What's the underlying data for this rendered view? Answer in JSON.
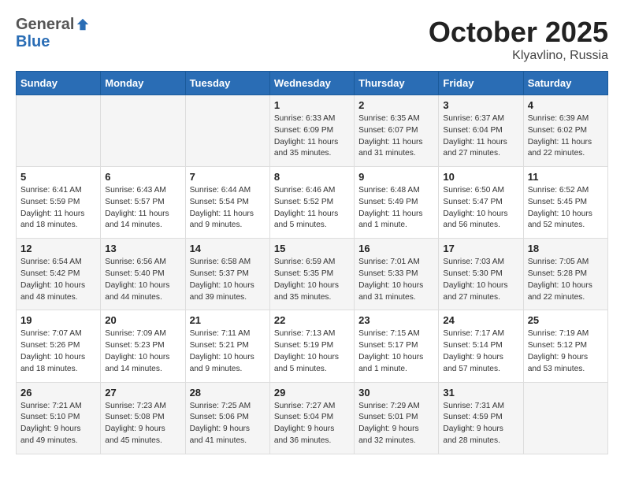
{
  "header": {
    "logo": {
      "general": "General",
      "blue": "Blue"
    },
    "title": "October 2025",
    "location": "Klyavlino, Russia"
  },
  "weekdays": [
    "Sunday",
    "Monday",
    "Tuesday",
    "Wednesday",
    "Thursday",
    "Friday",
    "Saturday"
  ],
  "weeks": [
    [
      {
        "day": "",
        "content": ""
      },
      {
        "day": "",
        "content": ""
      },
      {
        "day": "",
        "content": ""
      },
      {
        "day": "1",
        "content": "Sunrise: 6:33 AM\nSunset: 6:09 PM\nDaylight: 11 hours\nand 35 minutes."
      },
      {
        "day": "2",
        "content": "Sunrise: 6:35 AM\nSunset: 6:07 PM\nDaylight: 11 hours\nand 31 minutes."
      },
      {
        "day": "3",
        "content": "Sunrise: 6:37 AM\nSunset: 6:04 PM\nDaylight: 11 hours\nand 27 minutes."
      },
      {
        "day": "4",
        "content": "Sunrise: 6:39 AM\nSunset: 6:02 PM\nDaylight: 11 hours\nand 22 minutes."
      }
    ],
    [
      {
        "day": "5",
        "content": "Sunrise: 6:41 AM\nSunset: 5:59 PM\nDaylight: 11 hours\nand 18 minutes."
      },
      {
        "day": "6",
        "content": "Sunrise: 6:43 AM\nSunset: 5:57 PM\nDaylight: 11 hours\nand 14 minutes."
      },
      {
        "day": "7",
        "content": "Sunrise: 6:44 AM\nSunset: 5:54 PM\nDaylight: 11 hours\nand 9 minutes."
      },
      {
        "day": "8",
        "content": "Sunrise: 6:46 AM\nSunset: 5:52 PM\nDaylight: 11 hours\nand 5 minutes."
      },
      {
        "day": "9",
        "content": "Sunrise: 6:48 AM\nSunset: 5:49 PM\nDaylight: 11 hours\nand 1 minute."
      },
      {
        "day": "10",
        "content": "Sunrise: 6:50 AM\nSunset: 5:47 PM\nDaylight: 10 hours\nand 56 minutes."
      },
      {
        "day": "11",
        "content": "Sunrise: 6:52 AM\nSunset: 5:45 PM\nDaylight: 10 hours\nand 52 minutes."
      }
    ],
    [
      {
        "day": "12",
        "content": "Sunrise: 6:54 AM\nSunset: 5:42 PM\nDaylight: 10 hours\nand 48 minutes."
      },
      {
        "day": "13",
        "content": "Sunrise: 6:56 AM\nSunset: 5:40 PM\nDaylight: 10 hours\nand 44 minutes."
      },
      {
        "day": "14",
        "content": "Sunrise: 6:58 AM\nSunset: 5:37 PM\nDaylight: 10 hours\nand 39 minutes."
      },
      {
        "day": "15",
        "content": "Sunrise: 6:59 AM\nSunset: 5:35 PM\nDaylight: 10 hours\nand 35 minutes."
      },
      {
        "day": "16",
        "content": "Sunrise: 7:01 AM\nSunset: 5:33 PM\nDaylight: 10 hours\nand 31 minutes."
      },
      {
        "day": "17",
        "content": "Sunrise: 7:03 AM\nSunset: 5:30 PM\nDaylight: 10 hours\nand 27 minutes."
      },
      {
        "day": "18",
        "content": "Sunrise: 7:05 AM\nSunset: 5:28 PM\nDaylight: 10 hours\nand 22 minutes."
      }
    ],
    [
      {
        "day": "19",
        "content": "Sunrise: 7:07 AM\nSunset: 5:26 PM\nDaylight: 10 hours\nand 18 minutes."
      },
      {
        "day": "20",
        "content": "Sunrise: 7:09 AM\nSunset: 5:23 PM\nDaylight: 10 hours\nand 14 minutes."
      },
      {
        "day": "21",
        "content": "Sunrise: 7:11 AM\nSunset: 5:21 PM\nDaylight: 10 hours\nand 9 minutes."
      },
      {
        "day": "22",
        "content": "Sunrise: 7:13 AM\nSunset: 5:19 PM\nDaylight: 10 hours\nand 5 minutes."
      },
      {
        "day": "23",
        "content": "Sunrise: 7:15 AM\nSunset: 5:17 PM\nDaylight: 10 hours\nand 1 minute."
      },
      {
        "day": "24",
        "content": "Sunrise: 7:17 AM\nSunset: 5:14 PM\nDaylight: 9 hours\nand 57 minutes."
      },
      {
        "day": "25",
        "content": "Sunrise: 7:19 AM\nSunset: 5:12 PM\nDaylight: 9 hours\nand 53 minutes."
      }
    ],
    [
      {
        "day": "26",
        "content": "Sunrise: 7:21 AM\nSunset: 5:10 PM\nDaylight: 9 hours\nand 49 minutes."
      },
      {
        "day": "27",
        "content": "Sunrise: 7:23 AM\nSunset: 5:08 PM\nDaylight: 9 hours\nand 45 minutes."
      },
      {
        "day": "28",
        "content": "Sunrise: 7:25 AM\nSunset: 5:06 PM\nDaylight: 9 hours\nand 41 minutes."
      },
      {
        "day": "29",
        "content": "Sunrise: 7:27 AM\nSunset: 5:04 PM\nDaylight: 9 hours\nand 36 minutes."
      },
      {
        "day": "30",
        "content": "Sunrise: 7:29 AM\nSunset: 5:01 PM\nDaylight: 9 hours\nand 32 minutes."
      },
      {
        "day": "31",
        "content": "Sunrise: 7:31 AM\nSunset: 4:59 PM\nDaylight: 9 hours\nand 28 minutes."
      },
      {
        "day": "",
        "content": ""
      }
    ]
  ]
}
